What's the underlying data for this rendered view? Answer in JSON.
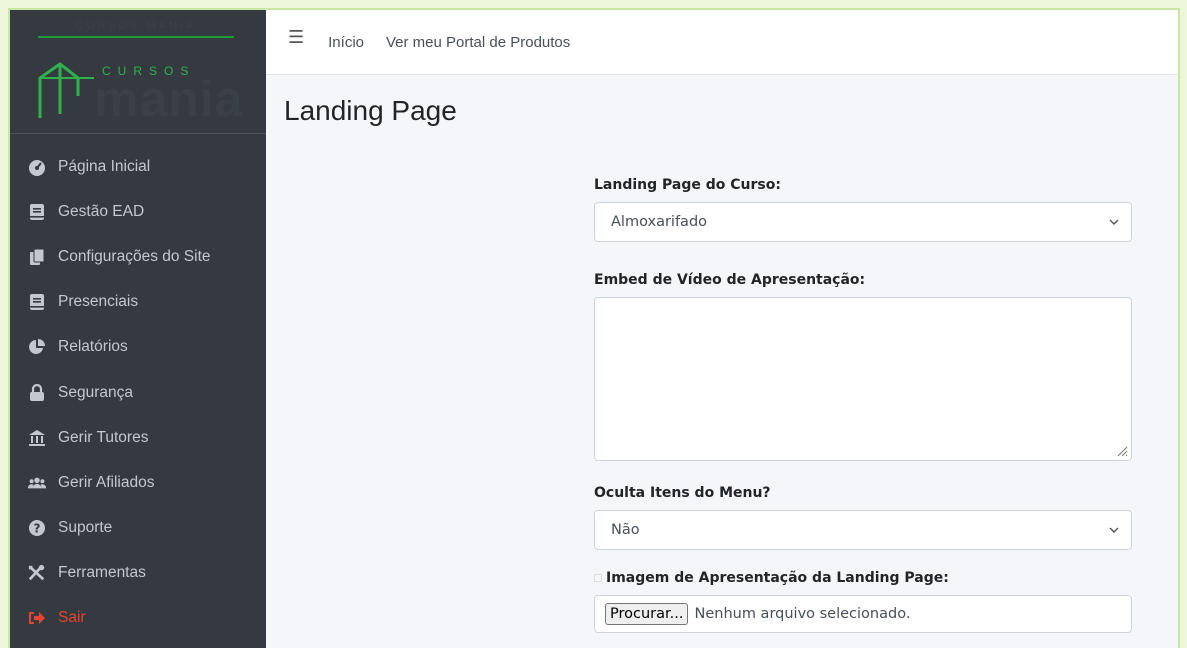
{
  "brand": {
    "top_text": "CURSOS MANIA",
    "cursos": "CURSOS",
    "mania": "mania"
  },
  "sidebar": {
    "items": [
      {
        "label": "Página Inicial",
        "icon": "tachometer-icon"
      },
      {
        "label": "Gestão EAD",
        "icon": "book-icon"
      },
      {
        "label": "Configurações do Site",
        "icon": "copy-icon"
      },
      {
        "label": "Presenciais",
        "icon": "book-icon"
      },
      {
        "label": "Relatórios",
        "icon": "pie-chart-icon"
      },
      {
        "label": "Segurança",
        "icon": "lock-icon"
      },
      {
        "label": "Gerir Tutores",
        "icon": "university-icon"
      },
      {
        "label": "Gerir Afiliados",
        "icon": "users-icon"
      },
      {
        "label": "Suporte",
        "icon": "question-circle-icon"
      },
      {
        "label": "Ferramentas",
        "icon": "tools-icon"
      },
      {
        "label": "Sair",
        "icon": "sign-out-icon"
      }
    ]
  },
  "topbar": {
    "home": "Início",
    "portal": "Ver meu Portal de Produtos"
  },
  "page": {
    "title": "Landing Page"
  },
  "form": {
    "course_label": "Landing Page do Curso:",
    "course_value": "Almoxarifado",
    "video_label": "Embed de Vídeo de Apresentação:",
    "video_value": "",
    "hide_menu_label": "Oculta Itens do Menu?",
    "hide_menu_value": "Não",
    "image_label": "Imagem de Apresentação da Landing Page:",
    "file_button": "Procurar...",
    "file_status": "Nenhum arquivo selecionado."
  },
  "colors": {
    "sidebar_bg": "#343a40",
    "sidebar_text": "#c2c7d0",
    "danger": "#e8432f",
    "brand_green": "#2fb24b"
  }
}
